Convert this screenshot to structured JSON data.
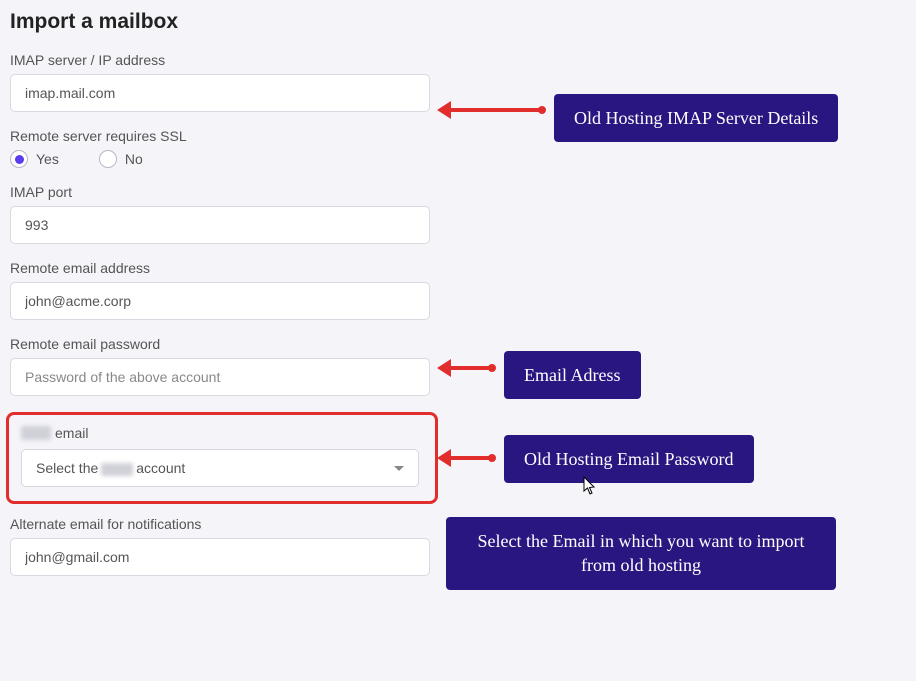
{
  "heading": "Import a mailbox",
  "fields": {
    "imap_server": {
      "label": "IMAP server / IP address",
      "value": "imap.mail.com"
    },
    "ssl": {
      "label": "Remote server requires SSL",
      "yes": "Yes",
      "no": "No"
    },
    "imap_port": {
      "label": "IMAP port",
      "value": "993"
    },
    "remote_email": {
      "label": "Remote email address",
      "value": "john@acme.corp"
    },
    "remote_password": {
      "label": "Remote email password",
      "placeholder": "Password of the above account"
    },
    "target_email": {
      "label_suffix": "email",
      "select_prefix": "Select the",
      "select_suffix": "account"
    },
    "alt_email": {
      "label": "Alternate email for notifications",
      "value": "john@gmail.com"
    }
  },
  "callouts": {
    "c1": "Old Hosting IMAP Server Details",
    "c2": "Email Adress",
    "c3": "Old Hosting Email Password",
    "c4": "Select the Email in which you want to import from old hosting"
  }
}
